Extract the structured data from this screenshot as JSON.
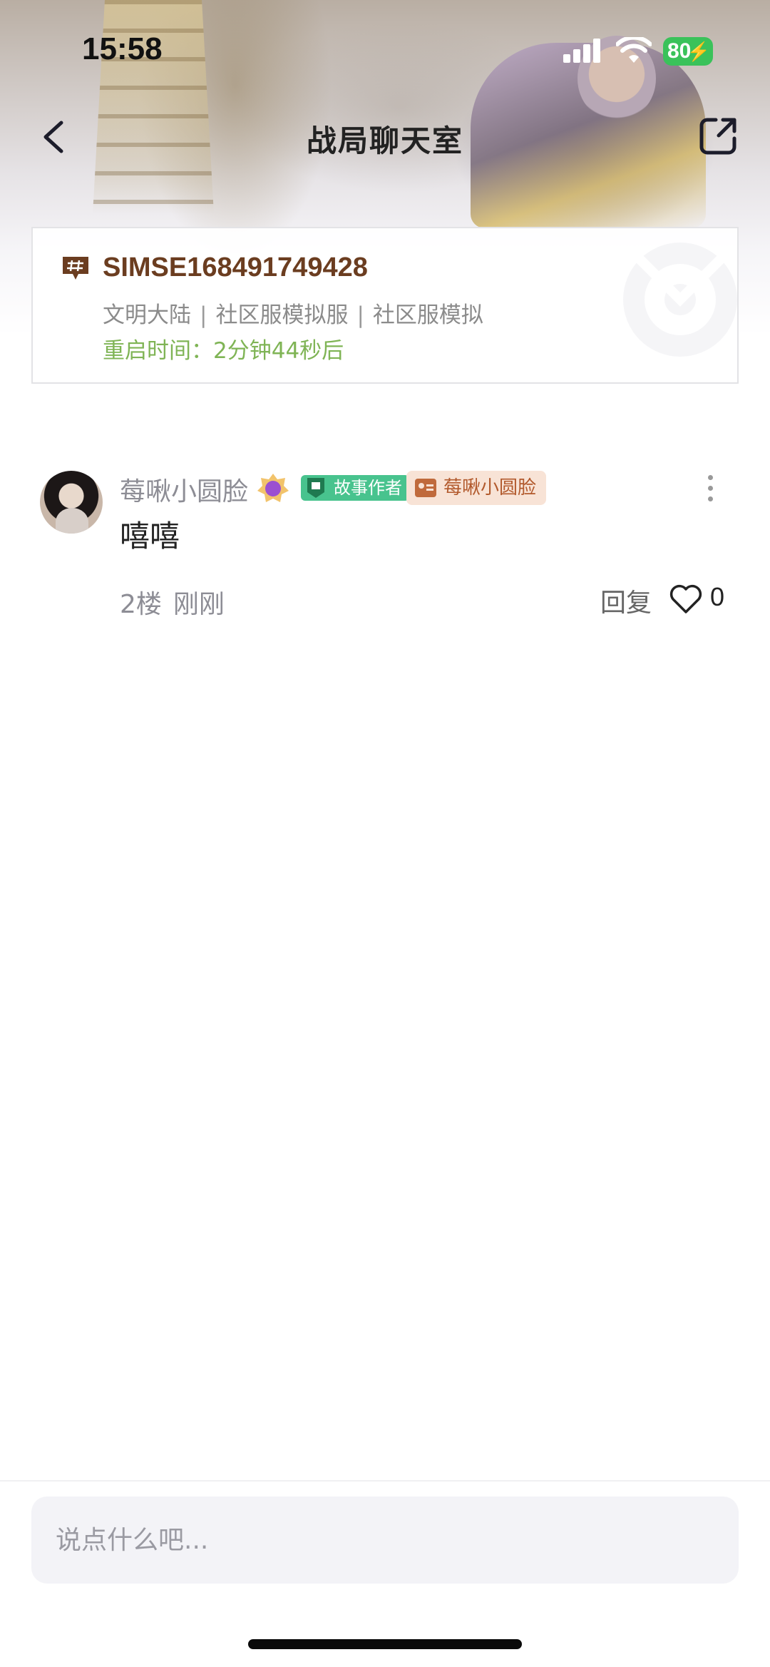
{
  "status_bar": {
    "time": "15:58",
    "battery": "80"
  },
  "nav": {
    "title": "战局聊天室"
  },
  "room": {
    "id": "SIMSE168491749428",
    "meta": [
      "文明大陆",
      "社区服模拟服",
      "社区服模拟"
    ],
    "meta_separator": "|",
    "restart_label": "重启时间：",
    "restart_value": "2分钟44秒后"
  },
  "post": {
    "username": "莓啾小圆脸",
    "tag_author": "故事作者",
    "tag_card": "莓啾小圆脸",
    "content": "嘻嘻",
    "floor": "2楼",
    "time_ago": "刚刚",
    "reply_label": "回复",
    "likes": "0"
  },
  "composer": {
    "placeholder": "说点什么吧..."
  },
  "colors": {
    "room_id": "#6b3d20",
    "restart": "#7fb455",
    "tag_author_bg": "#48c38e",
    "tag_card_bg": "#f8e3d6",
    "tag_card_text": "#b2592c",
    "battery": "#3ac25a"
  }
}
